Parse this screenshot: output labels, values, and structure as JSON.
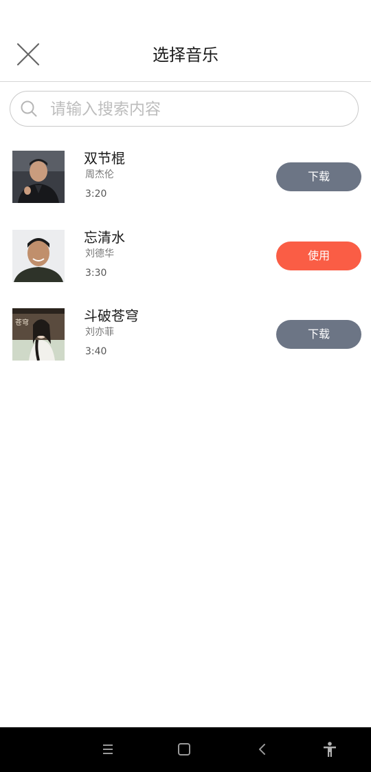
{
  "header": {
    "title": "选择音乐",
    "close_icon": "close-icon"
  },
  "search": {
    "placeholder": "请输入搜索内容",
    "value": "",
    "icon": "search-icon"
  },
  "songs": [
    {
      "title": "双节棍",
      "artist": "周杰伦",
      "duration": "3:20",
      "action_label": "下载",
      "action": "download",
      "action_color": "#6c7585"
    },
    {
      "title": "忘清水",
      "artist": "刘德华",
      "duration": "3:30",
      "action_label": "使用",
      "action": "use",
      "action_color": "#fa5d45"
    },
    {
      "title": "斗破苍穹",
      "artist": "刘亦菲",
      "duration": "3:40",
      "action_label": "下载",
      "action": "download",
      "action_color": "#6c7585"
    }
  ],
  "system_nav": {
    "icons": [
      "menu-icon",
      "home-icon",
      "back-icon",
      "accessibility-icon"
    ]
  },
  "colors": {
    "download_button": "#6c7585",
    "use_button": "#fa5d45",
    "nav_bar": "#000000"
  }
}
